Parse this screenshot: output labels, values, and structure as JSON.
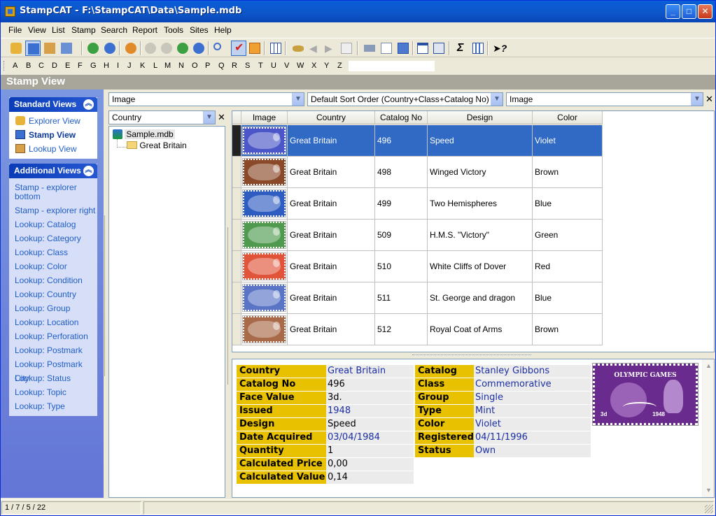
{
  "window": {
    "title": "StampCAT - F:\\StampCAT\\Data\\Sample.mdb",
    "controls": [
      "_",
      "□",
      "✕"
    ]
  },
  "menu": [
    "File",
    "View",
    "List",
    "Stamp",
    "Search",
    "Report",
    "Tools",
    "Sites",
    "Help"
  ],
  "alphabet": [
    "A",
    "B",
    "C",
    "D",
    "E",
    "F",
    "G",
    "H",
    "I",
    "J",
    "K",
    "L",
    "M",
    "N",
    "O",
    "P",
    "Q",
    "R",
    "S",
    "T",
    "U",
    "V",
    "W",
    "X",
    "Y",
    "Z"
  ],
  "view_header": "Stamp View",
  "standard_views": {
    "title": "Standard Views",
    "items": [
      "Explorer View",
      "Stamp View",
      "Lookup View"
    ]
  },
  "additional_views": {
    "title": "Additional Views",
    "items": [
      "Stamp - explorer bottom",
      "Stamp - explorer right",
      "Lookup: Catalog",
      "Lookup: Category",
      "Lookup: Class",
      "Lookup: Color",
      "Lookup: Condition",
      "Lookup: Country",
      "Lookup: Group",
      "Lookup: Location",
      "Lookup: Perforation",
      "Lookup: Postmark",
      "Lookup: Postmark City",
      "Lookup: Status",
      "Lookup: Topic",
      "Lookup: Type"
    ]
  },
  "combos": {
    "field": "Image",
    "sort": "Default Sort Order (Country+Class+Catalog No)",
    "image": "Image",
    "tree_field": "Country"
  },
  "tree": {
    "root": "Sample.mdb",
    "child": "Great Britain"
  },
  "grid": {
    "columns": [
      "Image",
      "Country",
      "Catalog No",
      "Design",
      "Color"
    ],
    "rows": [
      {
        "country": "Great Britain",
        "catalog_no": "496",
        "design": "Speed",
        "color": "Violet",
        "stamp_color": "#4b56c8",
        "selected": true
      },
      {
        "country": "Great Britain",
        "catalog_no": "498",
        "design": "Winged Victory",
        "color": "Brown",
        "stamp_color": "#8a4a2a",
        "selected": false
      },
      {
        "country": "Great Britain",
        "catalog_no": "499",
        "design": "Two Hemispheres",
        "color": "Blue",
        "stamp_color": "#2e5cc0",
        "selected": false
      },
      {
        "country": "Great Britain",
        "catalog_no": "509",
        "design": "H.M.S. \"Victory\"",
        "color": "Green",
        "stamp_color": "#4f9a4f",
        "selected": false
      },
      {
        "country": "Great Britain",
        "catalog_no": "510",
        "design": "White Cliffs of Dover",
        "color": "Red",
        "stamp_color": "#e0553a",
        "selected": false
      },
      {
        "country": "Great Britain",
        "catalog_no": "511",
        "design": "St. George and dragon",
        "color": "Blue",
        "stamp_color": "#5a74c6",
        "selected": false
      },
      {
        "country": "Great Britain",
        "catalog_no": "512",
        "design": "Royal Coat of Arms",
        "color": "Brown",
        "stamp_color": "#a86a48",
        "selected": false
      }
    ]
  },
  "detail": {
    "left": [
      {
        "label": "Country",
        "value": "Great Britain",
        "link": true
      },
      {
        "label": "Catalog No",
        "value": "496",
        "link": false
      },
      {
        "label": "Face Value",
        "value": "3d.",
        "link": false
      },
      {
        "label": "Issued",
        "value": "1948",
        "link": true
      },
      {
        "label": "Design",
        "value": "Speed",
        "link": false
      },
      {
        "label": "Date Acquired",
        "value": "03/04/1984",
        "link": true
      },
      {
        "label": "Quantity",
        "value": "1",
        "link": false
      },
      {
        "label": "Calculated Price",
        "value": "0,00",
        "link": false
      },
      {
        "label": "Calculated Value",
        "value": "0,14",
        "link": false
      }
    ],
    "right": [
      {
        "label": "Catalog",
        "value": "Stanley Gibbons",
        "link": true
      },
      {
        "label": "Class",
        "value": "Commemorative",
        "link": true
      },
      {
        "label": "Group",
        "value": "Single",
        "link": true
      },
      {
        "label": "Type",
        "value": "Mint",
        "link": true
      },
      {
        "label": "Color",
        "value": "Violet",
        "link": true
      },
      {
        "label": "Registered",
        "value": "04/11/1996",
        "link": true
      },
      {
        "label": "Status",
        "value": "Own",
        "link": true
      }
    ],
    "stamp_text": "OLYMPIC GAMES",
    "stamp_year": "1948",
    "stamp_face": "3d"
  },
  "status": {
    "counts": "1 / 7 / 5 / 22"
  },
  "colors": {
    "selection": "#316ac5",
    "label_bg": "#e8c100",
    "link": "#1c2fa4"
  }
}
